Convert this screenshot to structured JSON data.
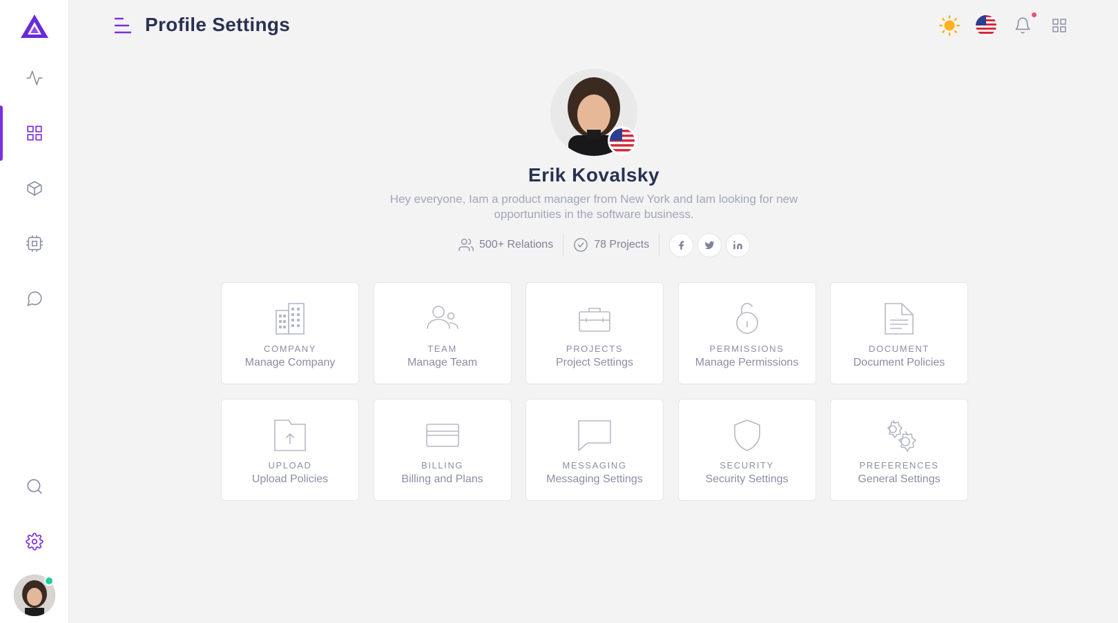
{
  "header": {
    "title": "Profile Settings"
  },
  "profile": {
    "name": "Erik Kovalsky",
    "bio": "Hey everyone, Iam a product manager from New York and Iam looking for new opportunities in the software business.",
    "relations": "500+ Relations",
    "projects": "78 Projects",
    "socials": [
      "f",
      "twitter",
      "in"
    ]
  },
  "sidebar": {
    "items": [
      {
        "icon": "activity-icon"
      },
      {
        "icon": "grid-icon",
        "active": true
      },
      {
        "icon": "box-icon"
      },
      {
        "icon": "cpu-icon"
      },
      {
        "icon": "message-icon"
      },
      {
        "icon": "search-icon"
      },
      {
        "icon": "gear-icon"
      }
    ]
  },
  "cards": [
    {
      "label": "COMPANY",
      "title": "Manage Company",
      "icon": "building-icon"
    },
    {
      "label": "TEAM",
      "title": "Manage Team",
      "icon": "users-icon"
    },
    {
      "label": "PROJECTS",
      "title": "Project Settings",
      "icon": "briefcase-icon"
    },
    {
      "label": "PERMISSIONS",
      "title": "Manage Permissions",
      "icon": "unlock-icon"
    },
    {
      "label": "DOCUMENT",
      "title": "Document Policies",
      "icon": "document-icon"
    },
    {
      "label": "UPLOAD",
      "title": "Upload Policies",
      "icon": "upload-folder-icon"
    },
    {
      "label": "BILLING",
      "title": "Billing and Plans",
      "icon": "credit-card-icon"
    },
    {
      "label": "MESSAGING",
      "title": "Messaging Settings",
      "icon": "message-square-icon"
    },
    {
      "label": "SECURITY",
      "title": "Security Settings",
      "icon": "shield-icon"
    },
    {
      "label": "PREFERENCES",
      "title": "General Settings",
      "icon": "gears-icon"
    }
  ],
  "colors": {
    "accent": "#7b2fe0",
    "icon_gray": "#8b8ea3",
    "sun": "#ffb21c",
    "online": "#1ccf9a",
    "notification": "#e8546e"
  }
}
